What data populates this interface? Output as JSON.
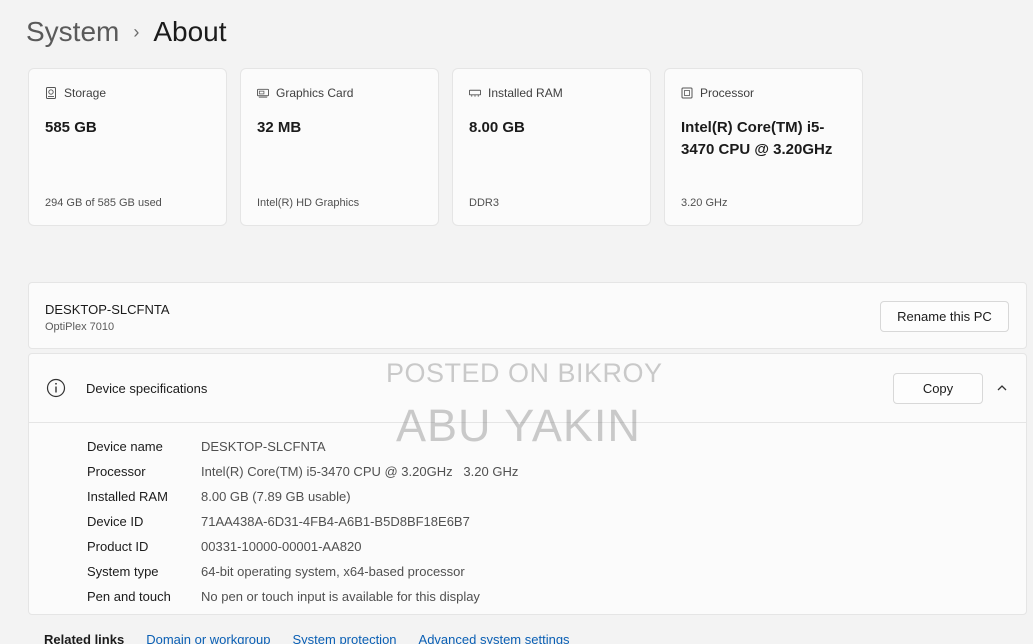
{
  "breadcrumb": {
    "parent": "System",
    "separator": "›",
    "current": "About"
  },
  "cards": [
    {
      "icon": "storage-icon",
      "label": "Storage",
      "value": "585 GB",
      "sub": "294 GB of 585 GB used"
    },
    {
      "icon": "graphics-card-icon",
      "label": "Graphics Card",
      "value": "32 MB",
      "sub": "Intel(R) HD Graphics"
    },
    {
      "icon": "ram-icon",
      "label": "Installed RAM",
      "value": "8.00 GB",
      "sub": "DDR3"
    },
    {
      "icon": "processor-icon",
      "label": "Processor",
      "value": "Intel(R) Core(TM) i5-3470 CPU @ 3.20GHz",
      "sub": "3.20 GHz"
    }
  ],
  "pc": {
    "name": "DESKTOP-SLCFNTA",
    "model": "OptiPlex 7010",
    "rename_label": "Rename this PC"
  },
  "specs": {
    "title": "Device specifications",
    "copy_label": "Copy",
    "rows": [
      {
        "label": "Device name",
        "value": "DESKTOP-SLCFNTA"
      },
      {
        "label": "Processor",
        "value": "Intel(R) Core(TM) i5-3470 CPU @ 3.20GHz   3.20 GHz"
      },
      {
        "label": "Installed RAM",
        "value": "8.00 GB (7.89 GB usable)"
      },
      {
        "label": "Device ID",
        "value": "71AA438A-6D31-4FB4-A6B1-B5D8BF18E6B7"
      },
      {
        "label": "Product ID",
        "value": "00331-10000-00001-AA820"
      },
      {
        "label": "System type",
        "value": "64-bit operating system, x64-based processor"
      },
      {
        "label": "Pen and touch",
        "value": "No pen or touch input is available for this display"
      }
    ]
  },
  "related": {
    "title": "Related links",
    "links": [
      "Domain or workgroup",
      "System protection",
      "Advanced system settings"
    ]
  },
  "watermark": {
    "line1": "POSTED ON BIKROY",
    "line2": "ABU YAKIN"
  }
}
